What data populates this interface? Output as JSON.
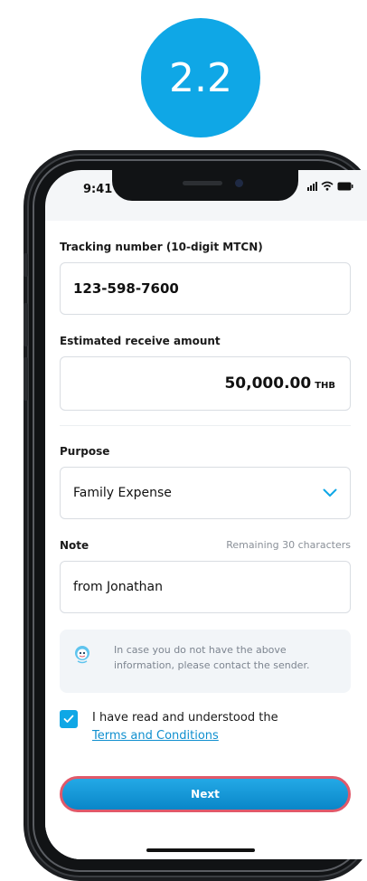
{
  "step": "2.2",
  "status_bar": {
    "time": "9:41"
  },
  "form": {
    "tracking": {
      "label": "Tracking number (10-digit MTCN)",
      "value": "123-598-7600"
    },
    "amount": {
      "label": "Estimated receive amount",
      "value": "50,000.00",
      "currency": "THB"
    },
    "purpose": {
      "label": "Purpose",
      "value": "Family Expense"
    },
    "note": {
      "label": "Note",
      "remaining": "Remaining 30 characters",
      "value": "from Jonathan"
    }
  },
  "info": {
    "text": "In case you do not have the above information, please contact the sender."
  },
  "terms": {
    "text": "I have read and understood the",
    "link": "Terms and Conditions",
    "checked": true
  },
  "next_button": {
    "label": "Next"
  },
  "colors": {
    "accent": "#0fa7e6",
    "highlight_border": "#e0596a"
  }
}
